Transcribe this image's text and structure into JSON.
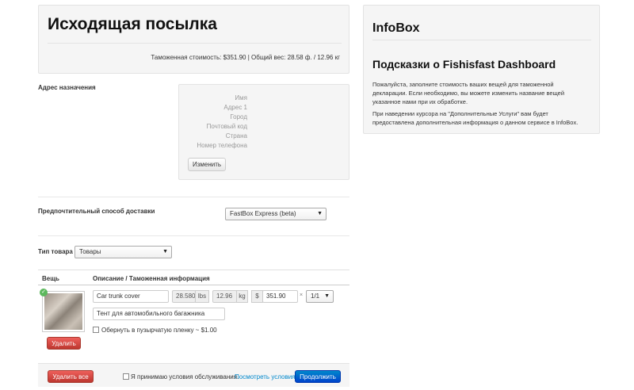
{
  "header": {
    "title": "Исходящая посылка",
    "summary": "Таможенная стоимость: $351.90 | Общий вес: 28.58 ф. / 12.96 кг"
  },
  "infobox": {
    "title": "InfoBox",
    "subtitle": "Подсказки о Fishisfast Dashboard",
    "p1": "Пожалуйста, заполните стоимость ваших вещей для таможенной декларации. Если необходимо, вы можете изменить название вещей указанное нами при их обработке.",
    "p2": "При наведении курсора на \"Дополнительные Услуги\" вам будет предоставлена дополнительная информация о данном сервисе в InfoBox."
  },
  "address": {
    "label": "Адрес назначения",
    "fields": [
      "Имя",
      "Адрес 1",
      "Город",
      "Почтовый код",
      "Страна",
      "Номер телефона"
    ],
    "change_button": "Изменить"
  },
  "shipping": {
    "label": "Предпочтительный способ доставки",
    "selected": "FastBox Express (beta)"
  },
  "product_type": {
    "label": "Тип товара",
    "selected": "Товары"
  },
  "table": {
    "col_item": "Вещь",
    "col_desc": "Описание / Таможенная информация",
    "row": {
      "description": "Car trunk cover",
      "weight_lbs": "28.580",
      "lbs_unit": "lbs",
      "weight_kg": "12.96",
      "kg_unit": "kg",
      "currency": "$",
      "price": "351.90",
      "times": "×",
      "quantity": "1/1",
      "description_ru": "Тент для автомобильного багажника",
      "wrap_label": "Обернуть в пузырчатую пленку ~ $1.00",
      "delete_button": "Удалить"
    }
  },
  "footer": {
    "delete_all": "Удалить все",
    "tos_text": "Я принимаю условия обслуживания.",
    "tos_link": "Посмотреть условия",
    "continue": "Продолжить"
  },
  "icons": {
    "check": "check-circle-icon",
    "dropdown": "chevron-down-icon"
  },
  "colors": {
    "danger": "#d9534f",
    "primary": "#0066cc",
    "success": "#5cb85c",
    "link": "#0088cc"
  }
}
